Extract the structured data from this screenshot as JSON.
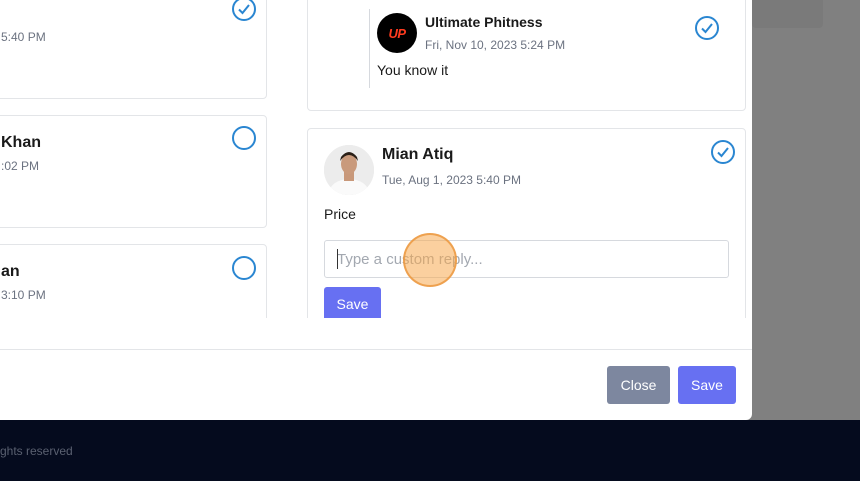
{
  "left_cards": [
    {
      "name": "",
      "date": "5:40 PM",
      "checked": true
    },
    {
      "name": "Khan",
      "date": ":02 PM",
      "checked": false
    },
    {
      "name": "an",
      "date": "3:10 PM",
      "checked": false
    }
  ],
  "reply_card": {
    "name": "Ultimate Phitness",
    "date": "Fri, Nov 10, 2023 5:24 PM",
    "message": "You know it",
    "avatar_text": "UP",
    "checked": true
  },
  "comment_card": {
    "name": "Mian Atiq",
    "date": "Tue, Aug 1, 2023 5:40 PM",
    "message": "Price",
    "checked": true,
    "reply_placeholder": "Type a custom reply...",
    "save_label": "Save"
  },
  "footer_buttons": {
    "close_label": "Close",
    "save_label": "Save"
  },
  "footer_text": "ghts reserved",
  "colors": {
    "accent": "#6770f2",
    "check_blue": "#2a86d1",
    "close_gray": "#7d879f",
    "footer_bg": "#050b1e"
  }
}
